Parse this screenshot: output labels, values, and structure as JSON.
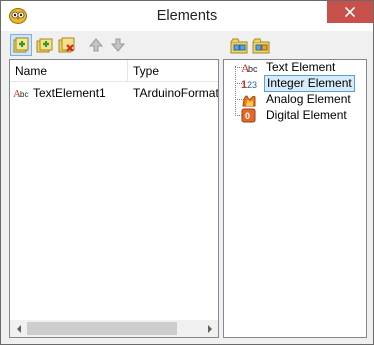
{
  "window": {
    "title": "Elements"
  },
  "toolbar_left": [
    {
      "name": "add-element-icon"
    },
    {
      "name": "add-folder-icon"
    },
    {
      "name": "delete-element-icon"
    },
    {
      "name": "move-up-icon"
    },
    {
      "name": "move-down-icon"
    }
  ],
  "toolbar_right": [
    {
      "name": "expand-all-icon"
    },
    {
      "name": "collapse-all-icon"
    }
  ],
  "list": {
    "columns": [
      "Name",
      "Type"
    ],
    "rows": [
      {
        "name": "TextElement1",
        "type": "TArduinoFormatte",
        "icon": "text-element-icon"
      }
    ]
  },
  "palette": {
    "items": [
      {
        "label": "Text Element",
        "icon": "text-element-icon",
        "selected": false
      },
      {
        "label": "Integer Element",
        "icon": "integer-element-icon",
        "selected": true
      },
      {
        "label": "Analog Element",
        "icon": "analog-element-icon",
        "selected": false
      },
      {
        "label": "Digital Element",
        "icon": "digital-element-icon",
        "selected": false
      }
    ]
  },
  "colors": {
    "close_button": "#c7504b",
    "selection_border": "#5aa0d8",
    "selection_fill": "#d6ecfb"
  }
}
